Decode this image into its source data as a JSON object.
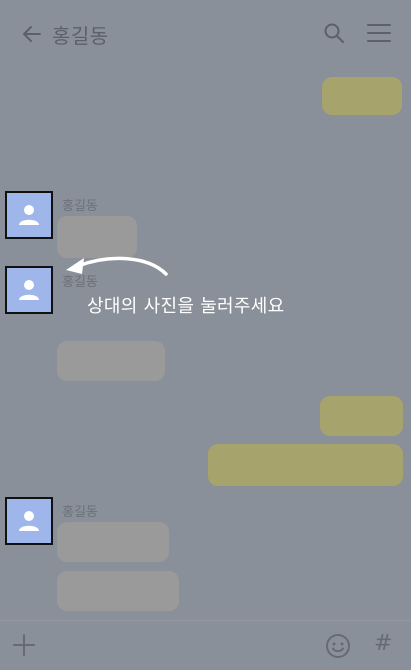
{
  "header": {
    "title": "홍길동",
    "back_icon": "back-arrow-icon",
    "search_icon": "search-icon",
    "menu_icon": "hamburger-menu-icon"
  },
  "messages": {
    "sender_name_1": "홍길동",
    "sender_name_2": "홍길동",
    "sender_name_3": "홍길동"
  },
  "overlay": {
    "hint": "상대의 사진을 눌러주세요"
  },
  "footer": {
    "plus_icon": "plus-icon",
    "emoji_icon": "emoji-icon",
    "hash_label": "#"
  },
  "colors": {
    "dim_background": "#8a9099",
    "my_bubble": "#a6a36d",
    "other_bubble": "#9a9a9a",
    "avatar_bg": "#9eb6ea"
  }
}
